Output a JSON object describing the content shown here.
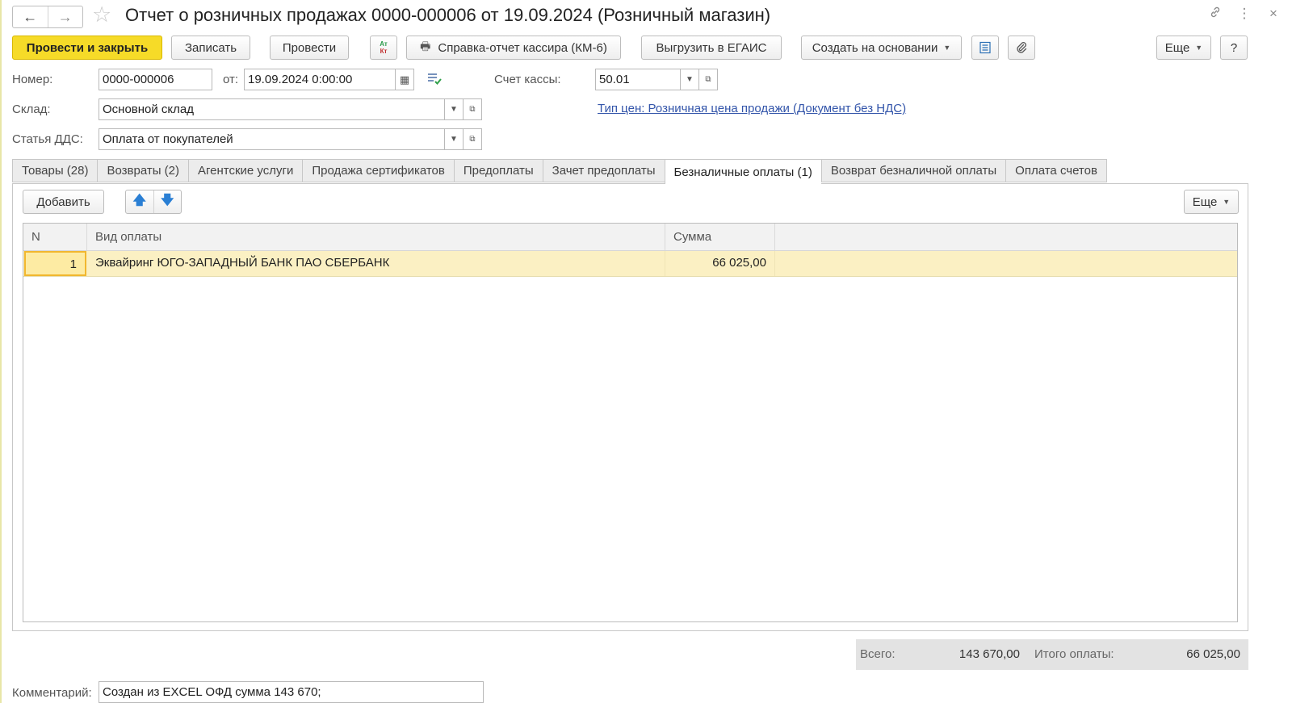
{
  "window": {
    "title": "Отчет о розничных продажах 0000-000006 от 19.09.2024 (Розничный магазин)",
    "nav_back": "←",
    "nav_forward": "→",
    "favorite_icon": "☆",
    "link_icon": "🔗",
    "more_icon": "⋮",
    "close_icon": "×"
  },
  "toolbar": {
    "post_and_close": "Провести и закрыть",
    "save": "Записать",
    "post": "Провести",
    "dtkt_top": "Ат",
    "dtkt_bottom": "Кт",
    "print_icon": "🖶",
    "cashier_report": "Справка-отчет кассира (КМ-6)",
    "export_egais": "Выгрузить в ЕГАИС",
    "create_based_on": "Создать на основании",
    "more": "Еще",
    "help": "?"
  },
  "form": {
    "number_label": "Номер:",
    "number_value": "0000-000006",
    "date_label": "от:",
    "date_value": "19.09.2024  0:00:00",
    "cash_account_label": "Счет кассы:",
    "cash_account_value": "50.01",
    "warehouse_label": "Склад:",
    "warehouse_value": "Основной склад",
    "price_type_link": "Тип цен: Розничная цена продажи (Документ без НДС)",
    "dds_label": "Статья ДДС:",
    "dds_value": "Оплата от покупателей"
  },
  "tabs": [
    {
      "label": "Товары (28)",
      "active": false
    },
    {
      "label": "Возвраты (2)",
      "active": false
    },
    {
      "label": "Агентские услуги",
      "active": false
    },
    {
      "label": "Продажа сертификатов",
      "active": false
    },
    {
      "label": "Предоплаты",
      "active": false
    },
    {
      "label": "Зачет предоплаты",
      "active": false
    },
    {
      "label": "Безналичные оплаты (1)",
      "active": true
    },
    {
      "label": "Возврат безналичной оплаты",
      "active": false
    },
    {
      "label": "Оплата счетов",
      "active": false
    }
  ],
  "table_toolbar": {
    "add": "Добавить",
    "up_icon": "🡅",
    "down_icon": "🡇",
    "more": "Еще"
  },
  "table": {
    "columns": [
      "N",
      "Вид оплаты",
      "Сумма"
    ],
    "rows": [
      {
        "n": "1",
        "payment_type": "Эквайринг ЮГО-ЗАПАДНЫЙ БАНК ПАО СБЕРБАНК",
        "amount": "66 025,00"
      }
    ]
  },
  "totals": {
    "total_label": "Всего:",
    "total_value": "143 670,00",
    "paid_label": "Итого оплаты:",
    "paid_value": "66 025,00"
  },
  "comment": {
    "label": "Комментарий:",
    "value": "Создан из EXCEL ОФД сумма 143 670;"
  }
}
